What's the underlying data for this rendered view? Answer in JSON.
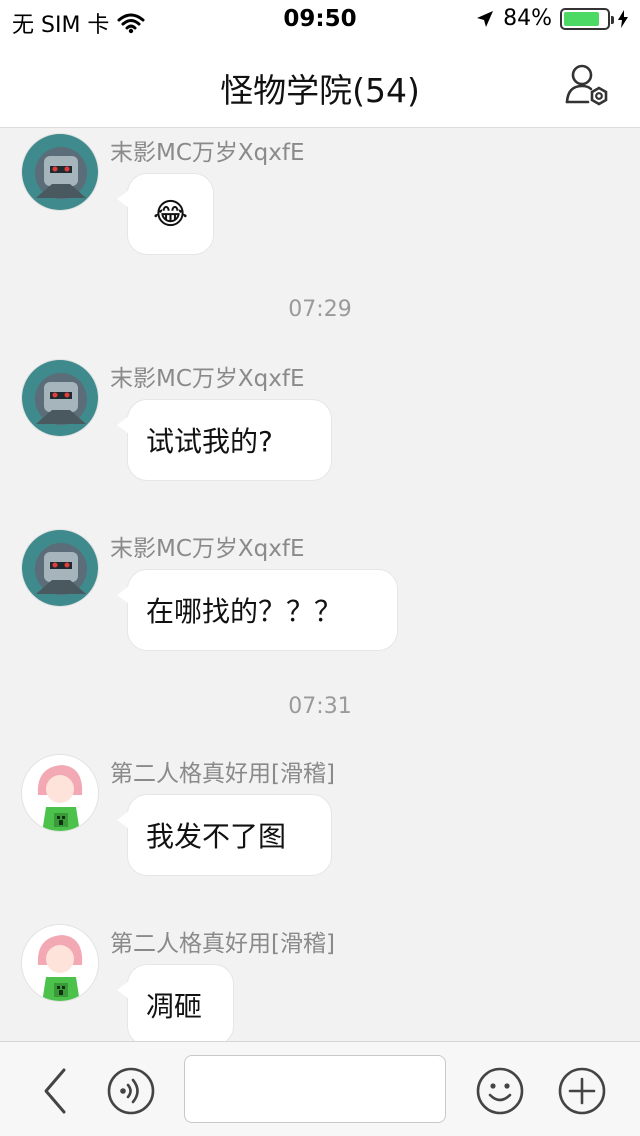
{
  "status_bar": {
    "carrier": "无 SIM 卡",
    "time": "09:50",
    "battery_percent": "84%",
    "battery_level": 0.84,
    "icons": [
      "wifi-icon",
      "location-arrow-icon",
      "battery-icon"
    ]
  },
  "header": {
    "title": "怪物学院(54)",
    "settings_icon": "group-settings-icon"
  },
  "messages": [
    {
      "sender": "末影MC万岁XqxfE",
      "text": "😂",
      "avatar": "robot-avatar"
    },
    {
      "sender": "末影MC万岁XqxfE",
      "text": "试试我的?",
      "avatar": "robot-avatar"
    },
    {
      "sender": "末影MC万岁XqxfE",
      "text": "在哪找的？？？",
      "avatar": "robot-avatar"
    },
    {
      "sender": "第二人格真好用[滑稽]",
      "text": "我发不了图",
      "avatar": "anime-girl-avatar"
    },
    {
      "sender": "第二人格真好用[滑稽]",
      "text": "凋砸",
      "avatar": "anime-girl-avatar"
    }
  ],
  "timestamps": [
    "07:29",
    "07:31"
  ],
  "input_bar": {
    "value": "",
    "placeholder": "",
    "icons": [
      "back-icon",
      "voice-icon",
      "emoji-icon",
      "add-icon"
    ]
  },
  "colors": {
    "chat_background": "#f2f2f2",
    "bubble": "#ffffff",
    "battery_fill": "#4cd964",
    "sender_text": "#8a8a8a"
  }
}
